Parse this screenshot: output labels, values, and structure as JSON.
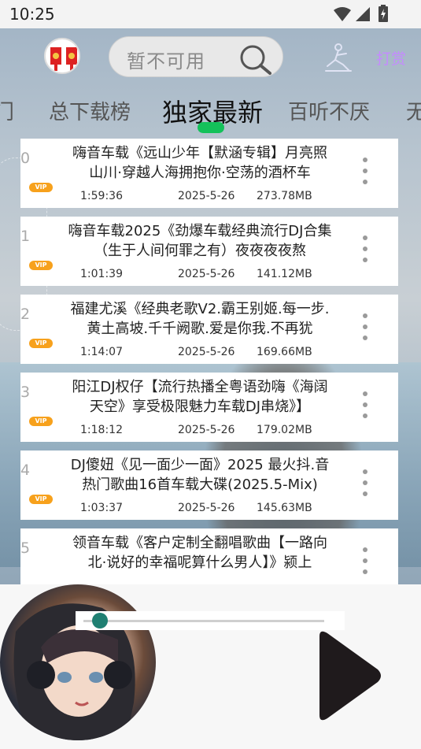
{
  "status": {
    "time": "10:25"
  },
  "search": {
    "placeholder": "暂不可用"
  },
  "header": {
    "reward_label": "打赏"
  },
  "tabs": [
    {
      "label": "门"
    },
    {
      "label": "总下载榜"
    },
    {
      "label": "独家最新",
      "active": true
    },
    {
      "label": "百听不厌"
    },
    {
      "label": "无"
    }
  ],
  "songs": [
    {
      "index": "0",
      "title": "嗨音车载《远山少年【默涵专辑】月亮照山川·穿越人海拥抱你·空荡的酒杯车",
      "duration": "1:59:36",
      "date": "2025-5-26",
      "size": "273.78MB"
    },
    {
      "index": "1",
      "title": "嗨音车载2025《劲爆车载经典流行DJ合集（生于人间何罪之有）夜夜夜夜熬",
      "duration": "1:01:39",
      "date": "2025-5-26",
      "size": "141.12MB"
    },
    {
      "index": "2",
      "title": "福建尤溪《经典老歌V2.霸王别姬.每一步.黄土高坡.千千阙歌.爱是你我.不再犹",
      "duration": "1:14:07",
      "date": "2025-5-26",
      "size": "169.66MB"
    },
    {
      "index": "3",
      "title": "阳江DJ权仔【流行热播全粤语劲嗨《海阔天空》享受极限魅力车载DJ串烧》】",
      "duration": "1:18:12",
      "date": "2025-5-26",
      "size": "179.02MB"
    },
    {
      "index": "4",
      "title": "DJ傻妞《见一面少一面》2025 最火抖.音 热门歌曲16首车载大碟(2025.5-Mix)",
      "duration": "1:03:37",
      "date": "2025-5-26",
      "size": "145.63MB"
    },
    {
      "index": "5",
      "title": "领音车载《客户定制全翻唱歌曲【一路向北·说好的幸福呢算什么男人】》颍上",
      "duration": "",
      "date": "",
      "size": ""
    }
  ],
  "vip_label": "VIP",
  "player": {
    "progress": 0.05
  },
  "colors": {
    "accent_green": "#14c15a",
    "vip_orange": "#f7a11c",
    "reward_purple": "#c58aff",
    "knob": "#1f7f72"
  }
}
